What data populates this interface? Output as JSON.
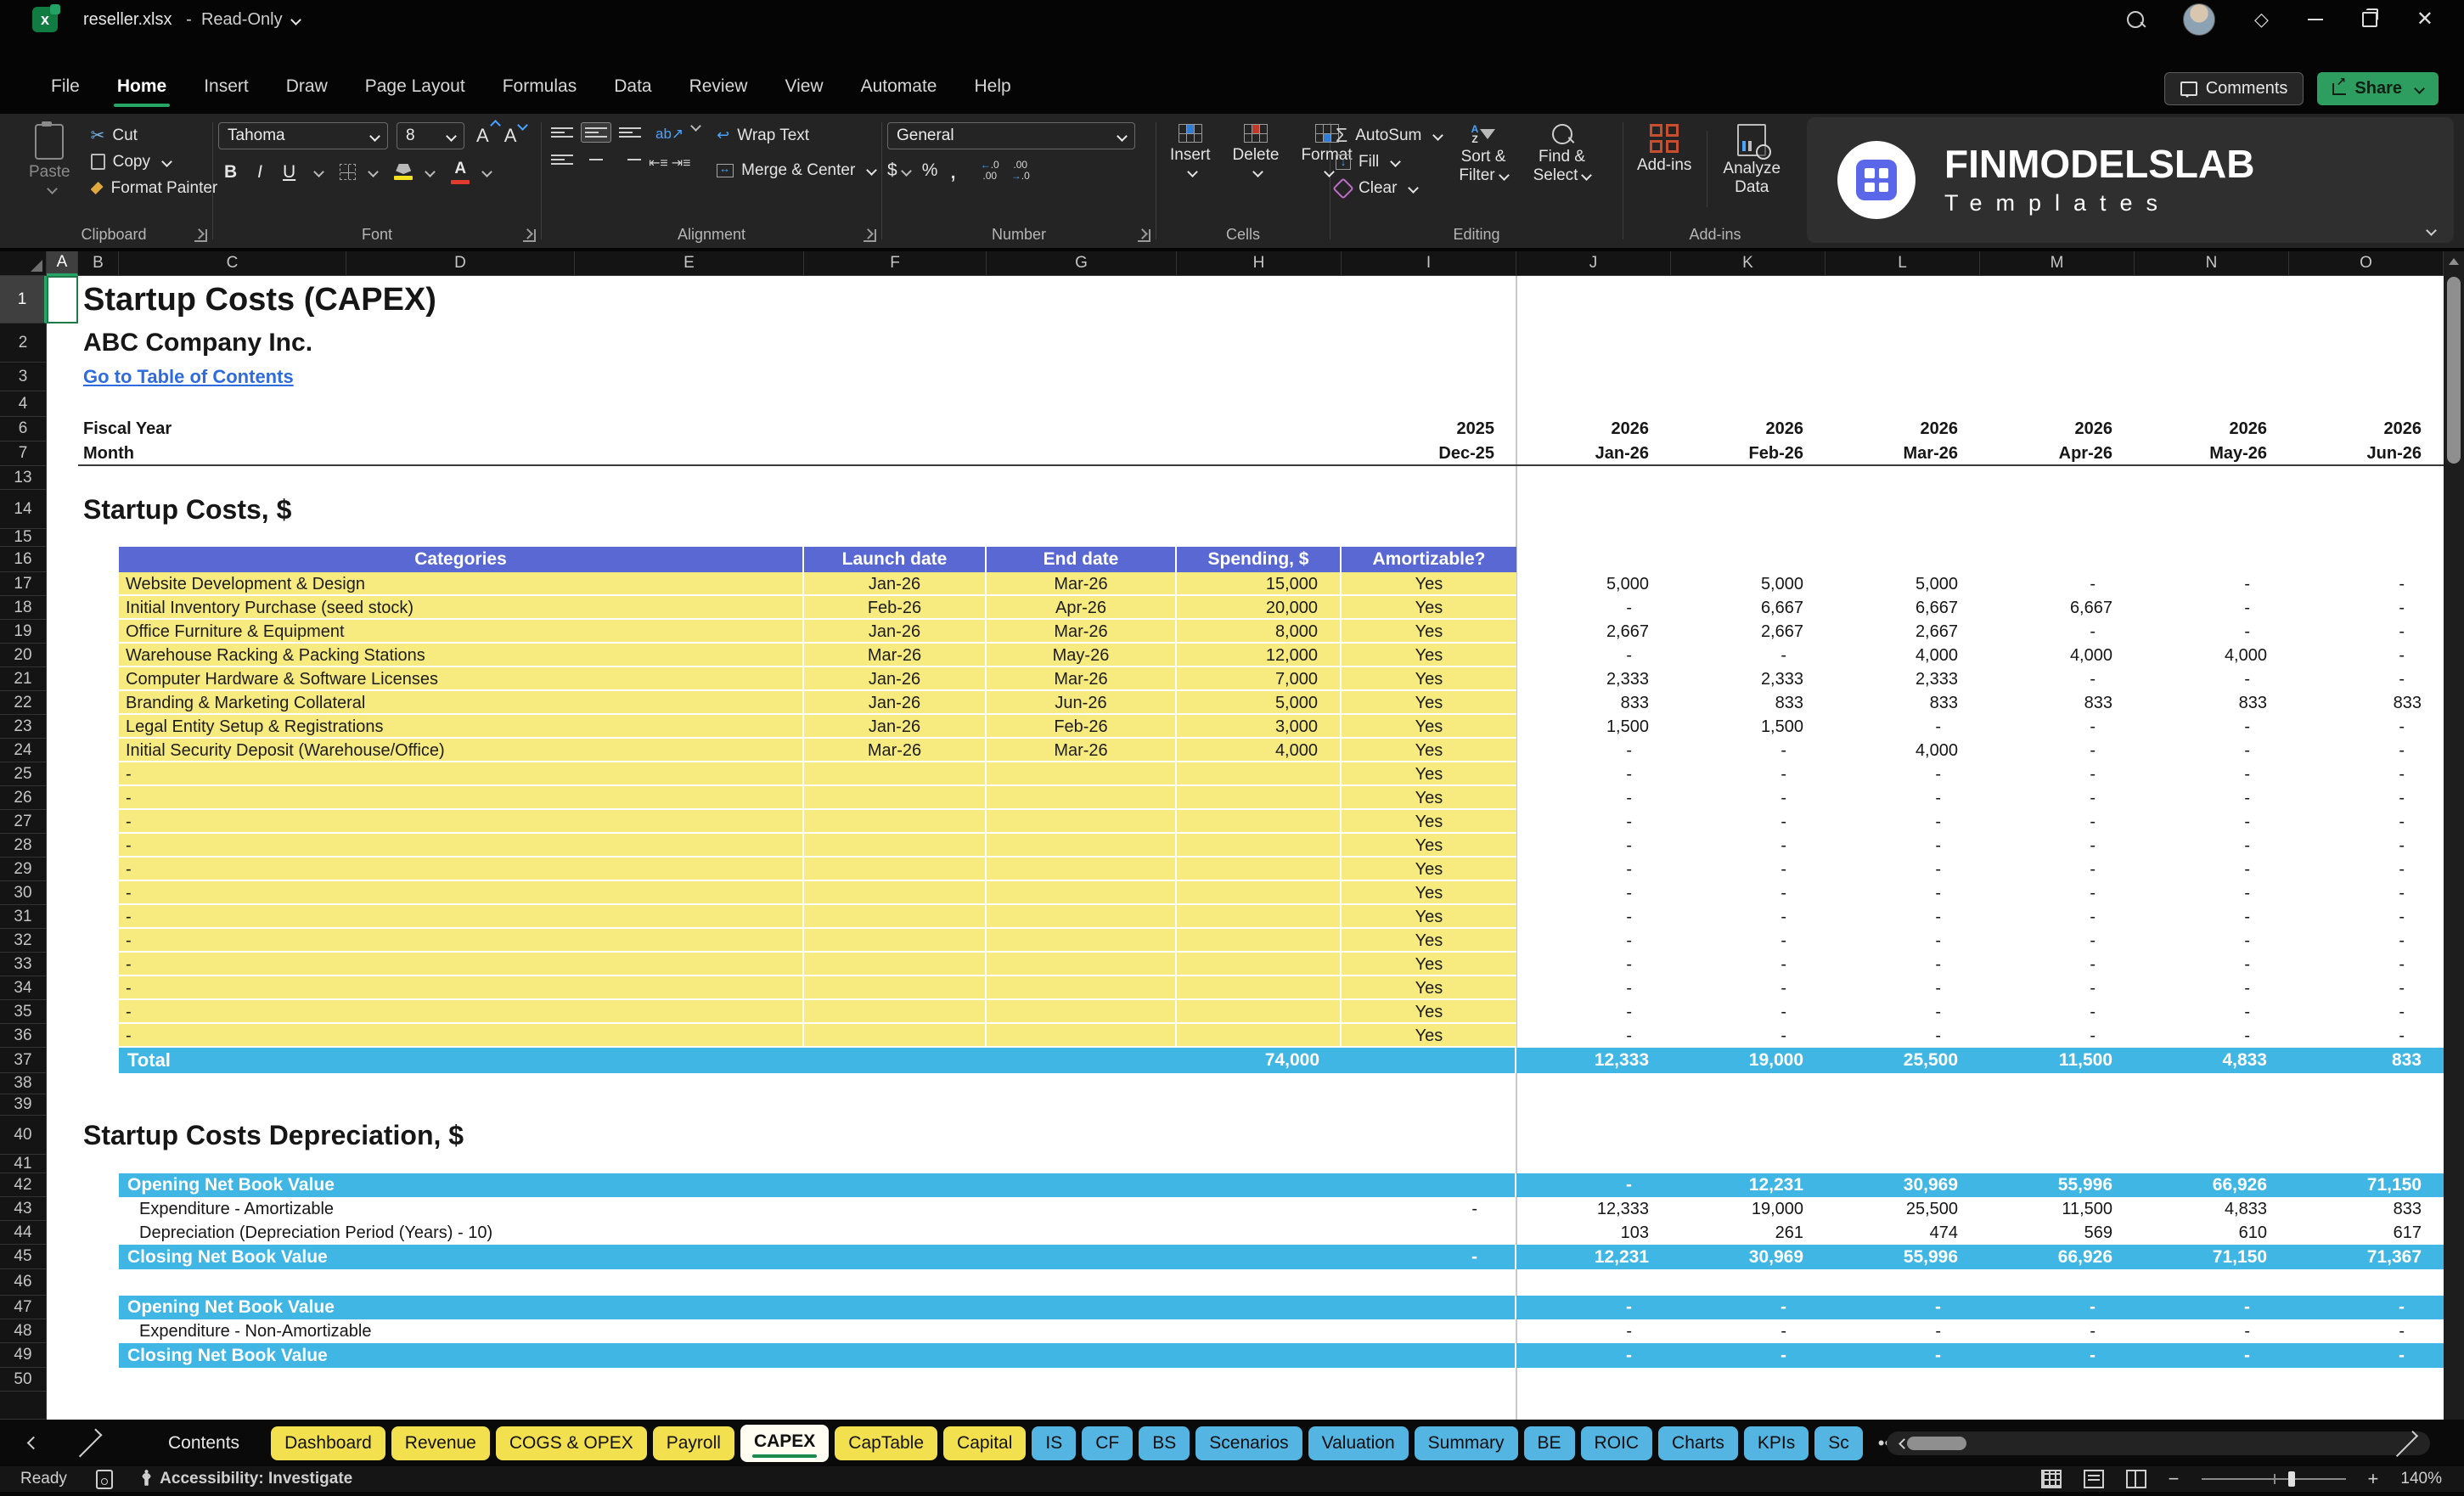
{
  "titlebar": {
    "filename": "reseller.xlsx",
    "separator": "-",
    "mode": "Read-Only"
  },
  "menu": {
    "items": [
      "File",
      "Home",
      "Insert",
      "Draw",
      "Page Layout",
      "Formulas",
      "Data",
      "Review",
      "View",
      "Automate",
      "Help"
    ],
    "active": "Home"
  },
  "actions": {
    "comments": "Comments",
    "share": "Share"
  },
  "ribbon": {
    "clipboard": {
      "label": "Clipboard",
      "paste": "Paste",
      "cut": "Cut",
      "copy": "Copy",
      "format_painter": "Format Painter"
    },
    "font": {
      "label": "Font",
      "font_name": "Tahoma",
      "font_size": "8",
      "bold": "B",
      "italic": "I",
      "underline": "U"
    },
    "alignment": {
      "label": "Alignment",
      "wrap_text": "Wrap Text",
      "merge_center": "Merge & Center"
    },
    "number": {
      "label": "Number",
      "format": "General",
      "currency": "$",
      "percent": "%",
      "comma": ","
    },
    "cells": {
      "label": "Cells",
      "insert": "Insert",
      "delete": "Delete",
      "format": "Format"
    },
    "editing": {
      "label": "Editing",
      "autosum": "AutoSum",
      "fill": "Fill",
      "clear": "Clear",
      "sort_line1": "Sort &",
      "sort_line2": "Filter",
      "find_line1": "Find &",
      "find_line2": "Select"
    },
    "addins": {
      "label": "Add-ins",
      "addins": "Add-ins",
      "analyze_line1": "Analyze",
      "analyze_line2": "Data"
    }
  },
  "logo": {
    "brand": "FINMODELSLAB",
    "sub": "Templates"
  },
  "grid": {
    "column_letters": [
      "A",
      "B",
      "C",
      "D",
      "E",
      "F",
      "G",
      "H",
      "I",
      "J",
      "K",
      "L",
      "M",
      "N",
      "O"
    ],
    "selected_column": "A",
    "selected_row": "1",
    "row_numbers": [
      "1",
      "2",
      "3",
      "4",
      "6",
      "7",
      "13",
      "14",
      "15",
      "16",
      "17",
      "18",
      "19",
      "20",
      "21",
      "22",
      "23",
      "24",
      "25",
      "26",
      "27",
      "28",
      "29",
      "30",
      "31",
      "32",
      "33",
      "34",
      "35",
      "36",
      "37",
      "38",
      "39",
      "40",
      "41",
      "42",
      "43",
      "44",
      "45",
      "46",
      "47",
      "48",
      "49",
      "50"
    ]
  },
  "sheet": {
    "title": "Startup Costs (CAPEX)",
    "company": "ABC Company Inc.",
    "toc_link": "Go to Table of Contents",
    "fiscal_year_label": "Fiscal Year",
    "month_label": "Month",
    "fiscal_years": [
      "2025",
      "2026",
      "2026",
      "2026",
      "2026",
      "2026",
      "2026"
    ],
    "months": [
      "Dec-25",
      "Jan-26",
      "Feb-26",
      "Mar-26",
      "Apr-26",
      "May-26",
      "Jun-26"
    ],
    "section1_heading": "Startup Costs, $",
    "table_headers": [
      "Categories",
      "Launch date",
      "End date",
      "Spending, $",
      "Amortizable?"
    ],
    "cost_rows": [
      {
        "category": "Website Development & Design",
        "launch": "Jan-26",
        "end": "Mar-26",
        "spending": "15,000",
        "amortizable": "Yes",
        "monthly": [
          "5,000",
          "5,000",
          "5,000",
          "-",
          "-",
          "-"
        ]
      },
      {
        "category": "Initial Inventory Purchase (seed stock)",
        "launch": "Feb-26",
        "end": "Apr-26",
        "spending": "20,000",
        "amortizable": "Yes",
        "monthly": [
          "-",
          "6,667",
          "6,667",
          "6,667",
          "-",
          "-"
        ]
      },
      {
        "category": "Office Furniture & Equipment",
        "launch": "Jan-26",
        "end": "Mar-26",
        "spending": "8,000",
        "amortizable": "Yes",
        "monthly": [
          "2,667",
          "2,667",
          "2,667",
          "-",
          "-",
          "-"
        ]
      },
      {
        "category": "Warehouse Racking & Packing Stations",
        "launch": "Mar-26",
        "end": "May-26",
        "spending": "12,000",
        "amortizable": "Yes",
        "monthly": [
          "-",
          "-",
          "4,000",
          "4,000",
          "4,000",
          "-"
        ]
      },
      {
        "category": "Computer Hardware & Software Licenses",
        "launch": "Jan-26",
        "end": "Mar-26",
        "spending": "7,000",
        "amortizable": "Yes",
        "monthly": [
          "2,333",
          "2,333",
          "2,333",
          "-",
          "-",
          "-"
        ]
      },
      {
        "category": "Branding & Marketing Collateral",
        "launch": "Jan-26",
        "end": "Jun-26",
        "spending": "5,000",
        "amortizable": "Yes",
        "monthly": [
          "833",
          "833",
          "833",
          "833",
          "833",
          "833"
        ]
      },
      {
        "category": "Legal Entity Setup & Registrations",
        "launch": "Jan-26",
        "end": "Feb-26",
        "spending": "3,000",
        "amortizable": "Yes",
        "monthly": [
          "1,500",
          "1,500",
          "-",
          "-",
          "-",
          "-"
        ]
      },
      {
        "category": "Initial Security Deposit (Warehouse/Office)",
        "launch": "Mar-26",
        "end": "Mar-26",
        "spending": "4,000",
        "amortizable": "Yes",
        "monthly": [
          "-",
          "-",
          "4,000",
          "-",
          "-",
          "-"
        ]
      },
      {
        "category": "-",
        "launch": "",
        "end": "",
        "spending": "",
        "amortizable": "Yes",
        "monthly": [
          "-",
          "-",
          "-",
          "-",
          "-",
          "-"
        ]
      },
      {
        "category": "-",
        "launch": "",
        "end": "",
        "spending": "",
        "amortizable": "Yes",
        "monthly": [
          "-",
          "-",
          "-",
          "-",
          "-",
          "-"
        ]
      },
      {
        "category": "-",
        "launch": "",
        "end": "",
        "spending": "",
        "amortizable": "Yes",
        "monthly": [
          "-",
          "-",
          "-",
          "-",
          "-",
          "-"
        ]
      },
      {
        "category": "-",
        "launch": "",
        "end": "",
        "spending": "",
        "amortizable": "Yes",
        "monthly": [
          "-",
          "-",
          "-",
          "-",
          "-",
          "-"
        ]
      },
      {
        "category": "-",
        "launch": "",
        "end": "",
        "spending": "",
        "amortizable": "Yes",
        "monthly": [
          "-",
          "-",
          "-",
          "-",
          "-",
          "-"
        ]
      },
      {
        "category": "-",
        "launch": "",
        "end": "",
        "spending": "",
        "amortizable": "Yes",
        "monthly": [
          "-",
          "-",
          "-",
          "-",
          "-",
          "-"
        ]
      },
      {
        "category": "-",
        "launch": "",
        "end": "",
        "spending": "",
        "amortizable": "Yes",
        "monthly": [
          "-",
          "-",
          "-",
          "-",
          "-",
          "-"
        ]
      },
      {
        "category": "-",
        "launch": "",
        "end": "",
        "spending": "",
        "amortizable": "Yes",
        "monthly": [
          "-",
          "-",
          "-",
          "-",
          "-",
          "-"
        ]
      },
      {
        "category": "-",
        "launch": "",
        "end": "",
        "spending": "",
        "amortizable": "Yes",
        "monthly": [
          "-",
          "-",
          "-",
          "-",
          "-",
          "-"
        ]
      },
      {
        "category": "-",
        "launch": "",
        "end": "",
        "spending": "",
        "amortizable": "Yes",
        "monthly": [
          "-",
          "-",
          "-",
          "-",
          "-",
          "-"
        ]
      },
      {
        "category": "-",
        "launch": "",
        "end": "",
        "spending": "",
        "amortizable": "Yes",
        "monthly": [
          "-",
          "-",
          "-",
          "-",
          "-",
          "-"
        ]
      },
      {
        "category": "-",
        "launch": "",
        "end": "",
        "spending": "",
        "amortizable": "Yes",
        "monthly": [
          "-",
          "-",
          "-",
          "-",
          "-",
          "-"
        ]
      }
    ],
    "total": {
      "label": "Total",
      "spending": "74,000",
      "monthly": [
        "12,333",
        "19,000",
        "25,500",
        "11,500",
        "4,833",
        "833"
      ]
    },
    "section2_heading": "Startup Costs Depreciation, $",
    "dep_block1": [
      {
        "label": "Opening Net Book Value",
        "style": "band",
        "col_i": "",
        "monthly": [
          "-",
          "12,231",
          "30,969",
          "55,996",
          "66,926",
          "71,150"
        ]
      },
      {
        "label": "Expenditure - Amortizable",
        "style": "plain",
        "col_i": "-",
        "monthly": [
          "12,333",
          "19,000",
          "25,500",
          "11,500",
          "4,833",
          "833"
        ]
      },
      {
        "label": "Depreciation (Depreciation Period (Years) - 10)",
        "style": "plain",
        "col_i": "",
        "monthly": [
          "103",
          "261",
          "474",
          "569",
          "610",
          "617"
        ]
      },
      {
        "label": "Closing Net Book Value",
        "style": "band",
        "col_i": "-",
        "monthly": [
          "12,231",
          "30,969",
          "55,996",
          "66,926",
          "71,150",
          "71,367"
        ]
      }
    ],
    "dep_block2": [
      {
        "label": "Opening Net Book Value",
        "style": "band",
        "col_i": "",
        "monthly": [
          "-",
          "-",
          "-",
          "-",
          "-",
          "-"
        ]
      },
      {
        "label": "Expenditure - Non-Amortizable",
        "style": "plain",
        "col_i": "",
        "monthly": [
          "-",
          "-",
          "-",
          "-",
          "-",
          "-"
        ]
      },
      {
        "label": "Closing Net Book Value",
        "style": "band",
        "col_i": "",
        "monthly": [
          "-",
          "-",
          "-",
          "-",
          "-",
          "-"
        ]
      }
    ]
  },
  "tabs": [
    {
      "label": "Contents",
      "type": "plain"
    },
    {
      "label": "Dashboard",
      "type": "yellow"
    },
    {
      "label": "Revenue",
      "type": "yellow"
    },
    {
      "label": "COGS & OPEX",
      "type": "yellow"
    },
    {
      "label": "Payroll",
      "type": "yellow"
    },
    {
      "label": "CAPEX",
      "type": "active"
    },
    {
      "label": "CapTable",
      "type": "yellow"
    },
    {
      "label": "Capital",
      "type": "yellow"
    },
    {
      "label": "IS",
      "type": "blue"
    },
    {
      "label": "CF",
      "type": "blue"
    },
    {
      "label": "BS",
      "type": "blue"
    },
    {
      "label": "Scenarios",
      "type": "blue"
    },
    {
      "label": "Valuation",
      "type": "blue"
    },
    {
      "label": "Summary",
      "type": "blue"
    },
    {
      "label": "BE",
      "type": "blue"
    },
    {
      "label": "ROIC",
      "type": "blue"
    },
    {
      "label": "Charts",
      "type": "blue"
    },
    {
      "label": "KPIs",
      "type": "blue"
    },
    {
      "label": "Sc",
      "type": "blue"
    }
  ],
  "statusbar": {
    "ready": "Ready",
    "accessibility": "Accessibility: Investigate",
    "zoom": "140%"
  },
  "colors": {
    "table_header": "#5a68d4",
    "table_fill": "#f7ea7e",
    "total_band": "#3fb6e3",
    "tab_yellow": "#f2e04e",
    "tab_blue": "#54b5e2",
    "accent_green": "#27a566",
    "share_green": "#2d9e5f",
    "hyperlink_blue": "#2e6bdf"
  }
}
